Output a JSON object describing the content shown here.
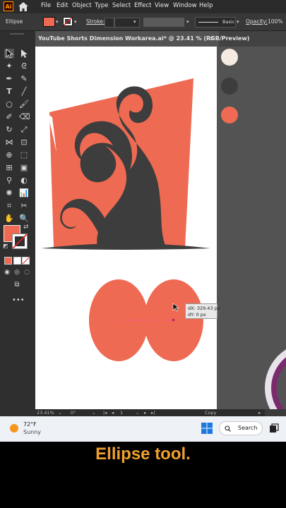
{
  "app": {
    "logo": "Ai"
  },
  "menu": [
    "File",
    "Edit",
    "Object",
    "Type",
    "Select",
    "Effect",
    "View",
    "Window",
    "Help"
  ],
  "control_bar": {
    "tool_name": "Ellipse",
    "fill_color": "#ee6a52",
    "stroke_label": "Stroke:",
    "brush_label": "Basic",
    "opacity_label": "Opacity:",
    "opacity_value": "100%"
  },
  "document": {
    "tab_title": "YouTube Shorts Dimension Workarea.ai* @ 23.41 % (RGB/Preview)",
    "close_glyph": "×"
  },
  "canvas": {
    "artwork_colors": {
      "background_shape": "#ee6a52",
      "swirl": "#3d3d3d"
    },
    "smart_guide": {
      "dx": "dX: 329.43 px",
      "dy": "dY: 0 px"
    },
    "ellipse_color": "#ee6a52"
  },
  "right_panel": {
    "swatches": [
      "#f5ebe1",
      "#3d3d3d",
      "#ee6a52"
    ]
  },
  "status_bar": {
    "zoom": "23.41%",
    "rotation": "0°",
    "artboard_number": "1",
    "mode": "Copy"
  },
  "taskbar": {
    "temperature": "72°F",
    "weather": "Sunny",
    "search_label": "Search"
  },
  "caption": "Ellipse tool."
}
